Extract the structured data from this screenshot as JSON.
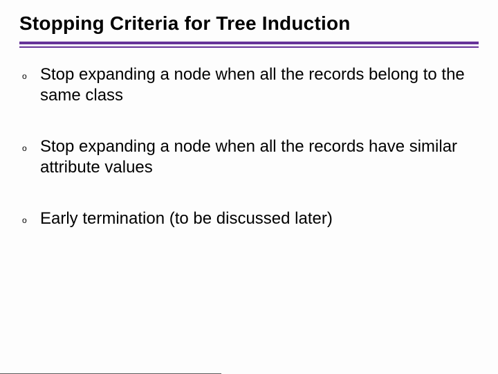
{
  "title": "Stopping Criteria for Tree Induction",
  "bullet_marker": "o",
  "bullets": [
    {
      "text": "Stop expanding a node when all the records belong to the same class"
    },
    {
      "text": "Stop expanding a node when all the records have similar attribute values"
    },
    {
      "text": "Early termination (to be discussed later)"
    }
  ],
  "colors": {
    "accent": "#663399"
  }
}
